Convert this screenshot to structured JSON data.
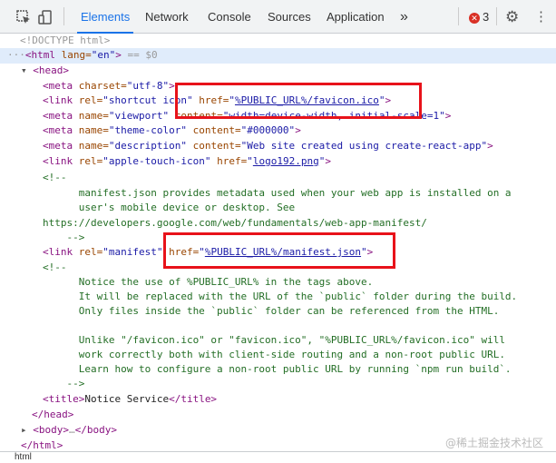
{
  "toolbar": {
    "tabs": [
      "Elements",
      "Network",
      "Console",
      "Sources",
      "Application"
    ],
    "more": "»",
    "error_count": "3"
  },
  "dom": {
    "l1": "<!DOCTYPE html>",
    "html_open_tag": "<html",
    "html_attr": " lang=",
    "html_val": "\"en\"",
    "html_close": ">",
    "selected_suffix": " == $0",
    "head_open": "<head>",
    "meta_charset": {
      "t1": "<meta",
      "a": " charset=",
      "v": "\"utf-8\"",
      "t2": ">"
    },
    "link_icon": {
      "t1": "<link",
      "a1": " rel=",
      "v1": "\"shortcut icon\"",
      "a2": " href=",
      "q1": "\"",
      "href": "%PUBLIC_URL%/favicon.ico",
      "q2": "\"",
      "t2": ">"
    },
    "meta_viewport": {
      "t1": "<meta",
      "a1": " name=",
      "v1": "\"viewport\"",
      "a2": " content=",
      "v2": "\"width=device-width, initial-scale=1\"",
      "t2": ">"
    },
    "meta_theme": {
      "t1": "<meta",
      "a1": " name=",
      "v1": "\"theme-color\"",
      "a2": " content=",
      "v2": "\"#000000\"",
      "t2": ">"
    },
    "meta_desc": {
      "t1": "<meta",
      "a1": " name=",
      "v1": "\"description\"",
      "a2": " content=",
      "v2": "\"Web site created using create-react-app\"",
      "t2": ">"
    },
    "link_apple": {
      "t1": "<link",
      "a1": " rel=",
      "v1": "\"apple-touch-icon\"",
      "a2": " href=",
      "q1": "\"",
      "href": "logo192.png",
      "q2": "\"",
      "t2": ">"
    },
    "comment1": [
      "<!--",
      "      manifest.json provides metadata used when your web app is installed on a",
      "      user's mobile device or desktop. See",
      "https://developers.google.com/web/fundamentals/web-app-manifest/",
      "    -->"
    ],
    "link_manifest": {
      "t1": "<link",
      "a1": " rel=",
      "v1": "\"manifest\"",
      "a2": " href=",
      "q1": "\"",
      "href": "%PUBLIC_URL%/manifest.json",
      "q2": "\"",
      "t2": ">"
    },
    "comment2": [
      "<!--",
      "      Notice the use of %PUBLIC_URL% in the tags above.",
      "      It will be replaced with the URL of the `public` folder during the build.",
      "      Only files inside the `public` folder can be referenced from the HTML.",
      "",
      "      Unlike \"/favicon.ico\" or \"favicon.ico\", \"%PUBLIC_URL%/favicon.ico\" will",
      "      work correctly both with client-side routing and a non-root public URL.",
      "      Learn how to configure a non-root public URL by running `npm run build`.",
      "    -->"
    ],
    "title": {
      "t1": "<title>",
      "text": "Notice Service",
      "t2": "</title>"
    },
    "head_close": "</head>",
    "body": {
      "t1": "<body>",
      "dots": "…",
      "t2": "</body>"
    },
    "html_close_tag": "</html>"
  },
  "breadcrumb": "html",
  "watermark": "@稀土掘金技术社区",
  "colors": {
    "tag": "#881280",
    "attr": "#994500",
    "value": "#1a1aa6",
    "comment": "#236e25",
    "accent": "#1a73e8",
    "highlight_box": "#e8121a",
    "error": "#d93025"
  }
}
